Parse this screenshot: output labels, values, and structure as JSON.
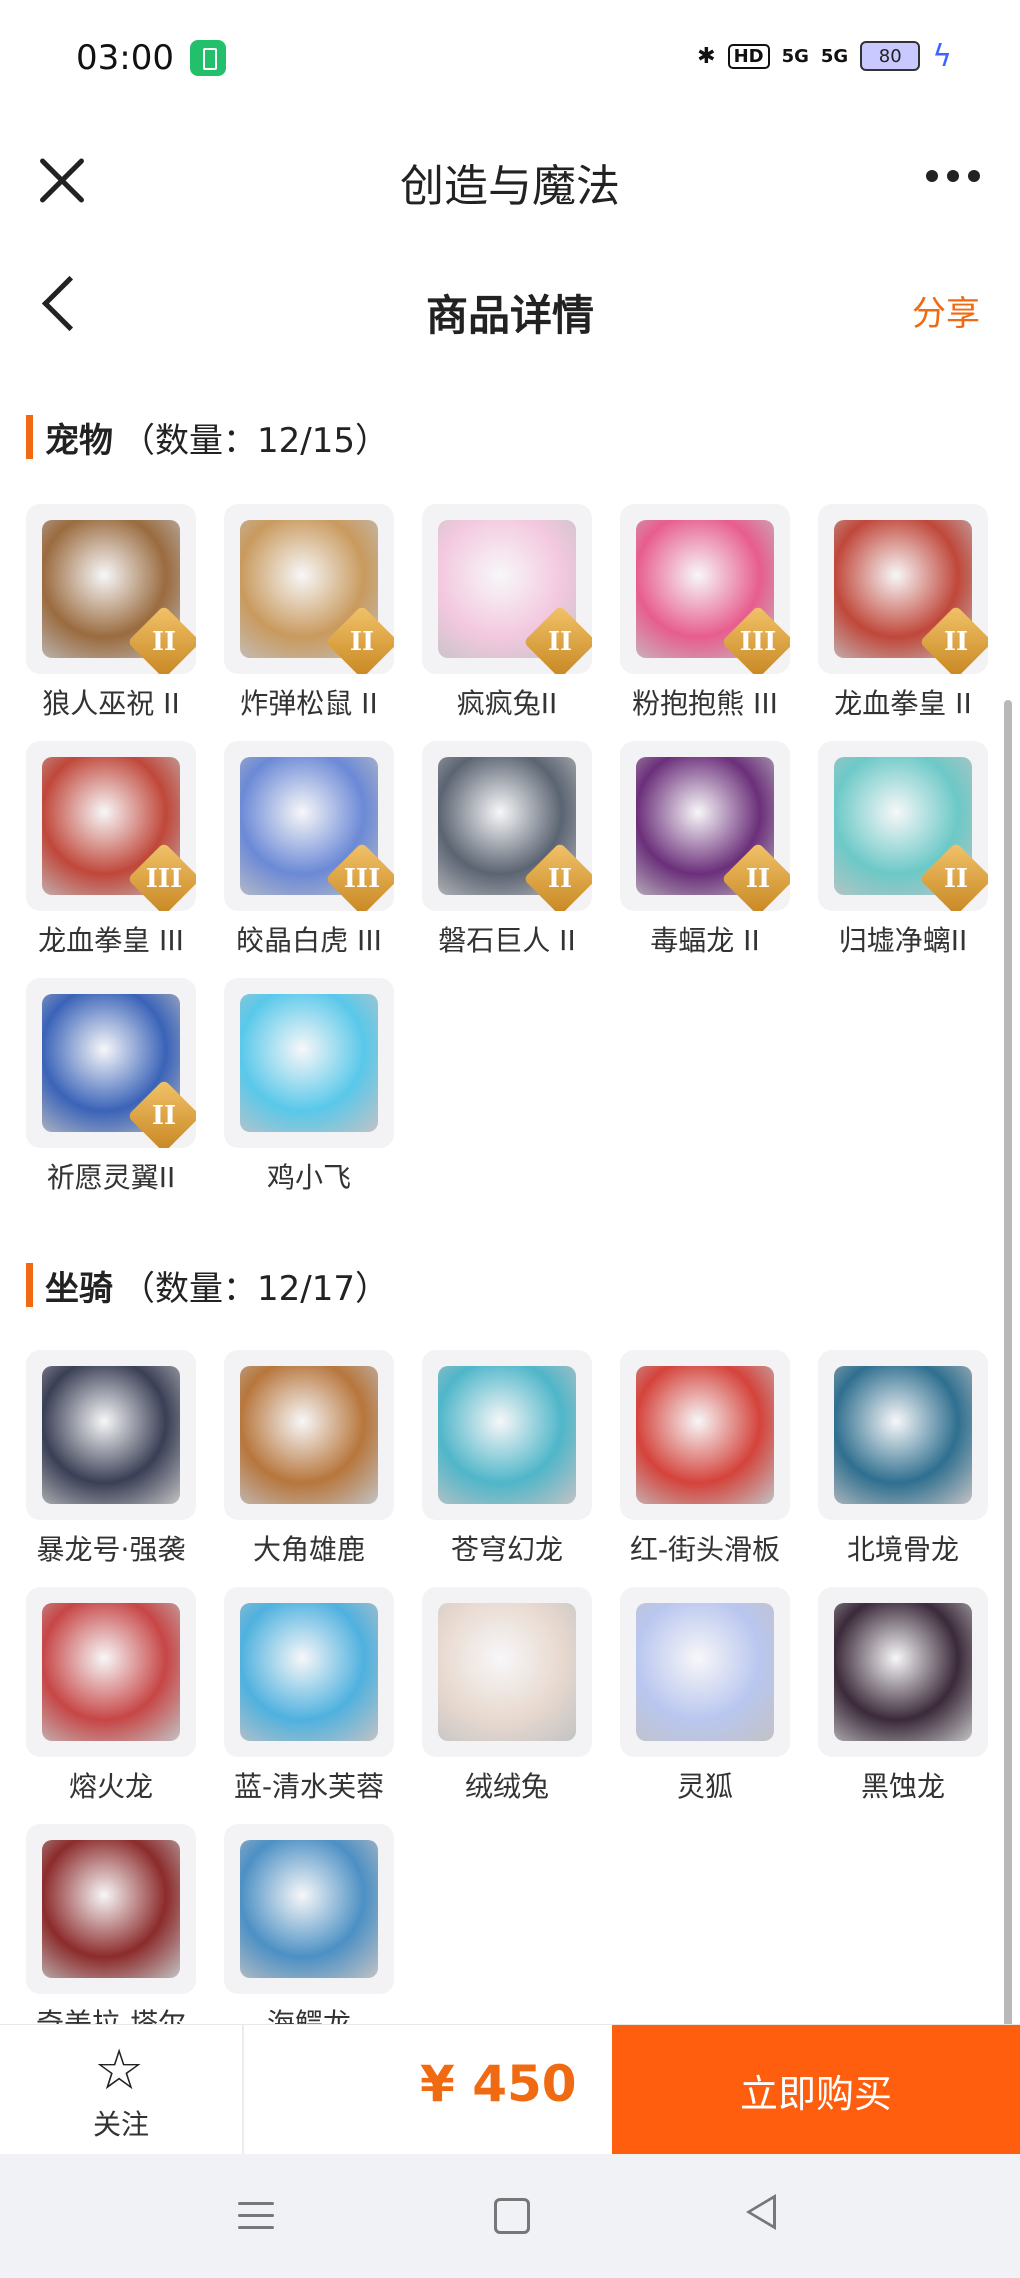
{
  "status": {
    "time": "03:00",
    "right": {
      "bt": "✱",
      "hd": "HD",
      "sig1": "5G",
      "sig2": "5G",
      "battery": "80",
      "bolt": "ϟ"
    }
  },
  "app": {
    "title": "创造与魔法"
  },
  "page": {
    "title": "商品详情",
    "share": "分享"
  },
  "sections": {
    "pets": {
      "name": "宠物",
      "count": "（数量：12/15）",
      "items": [
        {
          "name": "狼人巫祝 II",
          "tier": "II",
          "color": "#9a6b3f"
        },
        {
          "name": "炸弹松鼠 II",
          "tier": "II",
          "color": "#c99a5e"
        },
        {
          "name": "疯疯兔II",
          "tier": "II",
          "color": "#f3c8df"
        },
        {
          "name": "粉抱抱熊 III",
          "tier": "III",
          "color": "#e75d8e"
        },
        {
          "name": "龙血拳皇 II",
          "tier": "II",
          "color": "#c0473a"
        },
        {
          "name": "龙血拳皇 III",
          "tier": "III",
          "color": "#c0473a"
        },
        {
          "name": "皎晶白虎 III",
          "tier": "III",
          "color": "#6b89d6"
        },
        {
          "name": "磐石巨人 II",
          "tier": "II",
          "color": "#5b6472"
        },
        {
          "name": "毒蝠龙 II",
          "tier": "II",
          "color": "#6b2f7a"
        },
        {
          "name": "归墟净螭II",
          "tier": "II",
          "color": "#6cc9c7"
        },
        {
          "name": "祈愿灵翼II",
          "tier": "II",
          "color": "#3a63b8"
        },
        {
          "name": "鸡小飞",
          "tier": "",
          "color": "#59c8ea"
        }
      ]
    },
    "mounts": {
      "name": "坐骑",
      "count": "（数量：12/17）",
      "items": [
        {
          "name": "暴龙号·强袭",
          "color": "#3a3f55"
        },
        {
          "name": "大角雄鹿",
          "color": "#b7763c"
        },
        {
          "name": "苍穹幻龙",
          "color": "#4fb6c9"
        },
        {
          "name": "红-街头滑板",
          "color": "#d4433b"
        },
        {
          "name": "北境骨龙",
          "color": "#2f6f8f"
        },
        {
          "name": "熔火龙",
          "color": "#c74646"
        },
        {
          "name": "蓝-清水芙蓉",
          "color": "#4fb1df"
        },
        {
          "name": "绒绒兔",
          "color": "#e8d9cf"
        },
        {
          "name": "灵狐",
          "color": "#b9c6ef"
        },
        {
          "name": "黑蚀龙",
          "color": "#3b2a3a"
        },
        {
          "name": "奇美拉-塔尔",
          "color": "#8c2b2b"
        },
        {
          "name": "海鳄龙",
          "color": "#4c90c4"
        }
      ]
    }
  },
  "bottom": {
    "follow": "关注",
    "follow_icon": "☆",
    "price": "¥ 450",
    "buy": "立即购买"
  }
}
